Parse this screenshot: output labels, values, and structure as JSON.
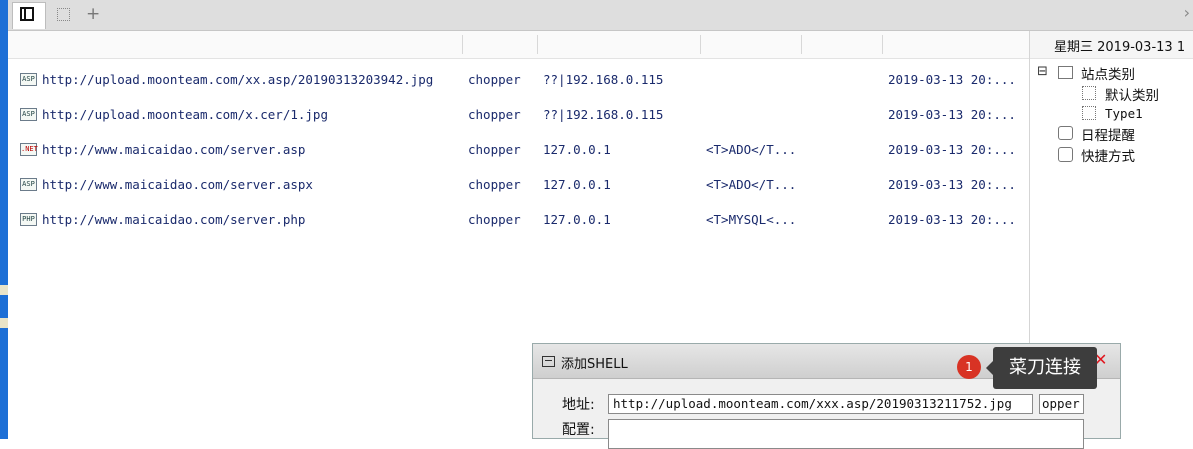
{
  "tabs": {
    "add_label": "+",
    "next_label": "›"
  },
  "rows": [
    {
      "icon": "ASP",
      "url": "http://upload.moonteam.com/xx.asp/20190313203942.jpg",
      "type": "chopper",
      "ip": "??|192.168.0.115",
      "note": "",
      "date": "2019-03-13 20:..."
    },
    {
      "icon": "ASP",
      "url": "http://upload.moonteam.com/x.cer/1.jpg",
      "type": "chopper",
      "ip": "??|192.168.0.115",
      "note": "",
      "date": "2019-03-13 20:..."
    },
    {
      "icon": ".NET",
      "url": "http://www.maicaidao.com/server.asp",
      "type": "chopper",
      "ip": "127.0.0.1",
      "note": "<T>ADO</T...",
      "date": "2019-03-13 20:..."
    },
    {
      "icon": "ASP",
      "url": "http://www.maicaidao.com/server.aspx",
      "type": "chopper",
      "ip": "127.0.0.1",
      "note": "<T>ADO</T...",
      "date": "2019-03-13 20:..."
    },
    {
      "icon": "PHP",
      "url": "http://www.maicaidao.com/server.php",
      "type": "chopper",
      "ip": "127.0.0.1",
      "note": "<T>MYSQL<...",
      "date": "2019-03-13 20:..."
    }
  ],
  "right_panel": {
    "date_header": "星期三 2019-03-13 1",
    "tree": {
      "collapse_symbol": "⊟",
      "site_category": "站点类别",
      "default_category": "默认类别",
      "type1": "Type1",
      "schedule": "日程提醒",
      "shortcuts": "快捷方式"
    }
  },
  "dialog": {
    "title": "添加SHELL",
    "close_label": "✕",
    "address_label": "地址:",
    "address_value": "http://upload.moonteam.com/xxx.asp/20190313211752.jpg",
    "type_value": "opper",
    "config_label": "配置:",
    "config_value": ""
  },
  "tooltip": {
    "badge": "1",
    "text": "菜刀连接"
  },
  "colors": {
    "accent_text": "#1a2a6c",
    "close_red": "#e0171f",
    "badge_red": "#d83324",
    "tooltip_bg": "#3d3d3d"
  }
}
